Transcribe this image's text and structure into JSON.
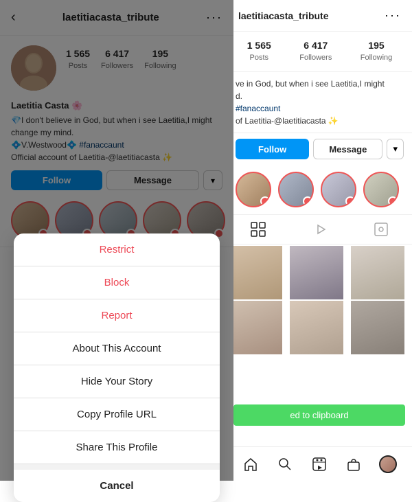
{
  "left": {
    "header": {
      "title": "laetitiacasta_tribute",
      "back_icon": "‹",
      "more_icon": "···"
    },
    "stats": [
      {
        "number": "1 565",
        "label": "Posts"
      },
      {
        "number": "6 417",
        "label": "Followers"
      },
      {
        "number": "195",
        "label": "Following"
      }
    ],
    "name": "Laetitia Casta 🌸",
    "bio": "💎I don't believe in God, but when i see  Laetitia,I might change my mind.\n💠V.Westwood💠 #fanaccaunt\nOfficial account of Laetitia-@laetitiacasta ✨",
    "follow_label": "Follow",
    "message_label": "Message",
    "dropdown_icon": "▾"
  },
  "right": {
    "header": {
      "title": "laetitiacasta_tribute",
      "more_icon": "···"
    },
    "stats": [
      {
        "number": "1 565",
        "label": "Posts"
      },
      {
        "number": "6 417",
        "label": "Followers"
      },
      {
        "number": "195",
        "label": "Following"
      }
    ],
    "bio_line1": "ve in God, but when i see  Laetitia,I might",
    "bio_line2": "d.",
    "bio_hashtag": "#fanaccaunt",
    "bio_line3": "of Laetitia-@laetitiacasta ✨",
    "message_label": "Message",
    "dropdown_icon": "▾"
  },
  "modal": {
    "items": [
      {
        "label": "Restrict",
        "type": "danger"
      },
      {
        "label": "Block",
        "type": "danger"
      },
      {
        "label": "Report",
        "type": "danger"
      },
      {
        "label": "About This Account",
        "type": "normal"
      },
      {
        "label": "Hide Your Story",
        "type": "normal"
      },
      {
        "label": "Copy Profile URL",
        "type": "normal"
      },
      {
        "label": "Share This Profile",
        "type": "normal"
      }
    ],
    "cancel_label": "Cancel"
  },
  "toast": {
    "text": "ed to clipboard"
  },
  "bottom_nav": {
    "icons": [
      "🏠",
      "🔍",
      "＋",
      "🎬",
      "🛍"
    ]
  }
}
